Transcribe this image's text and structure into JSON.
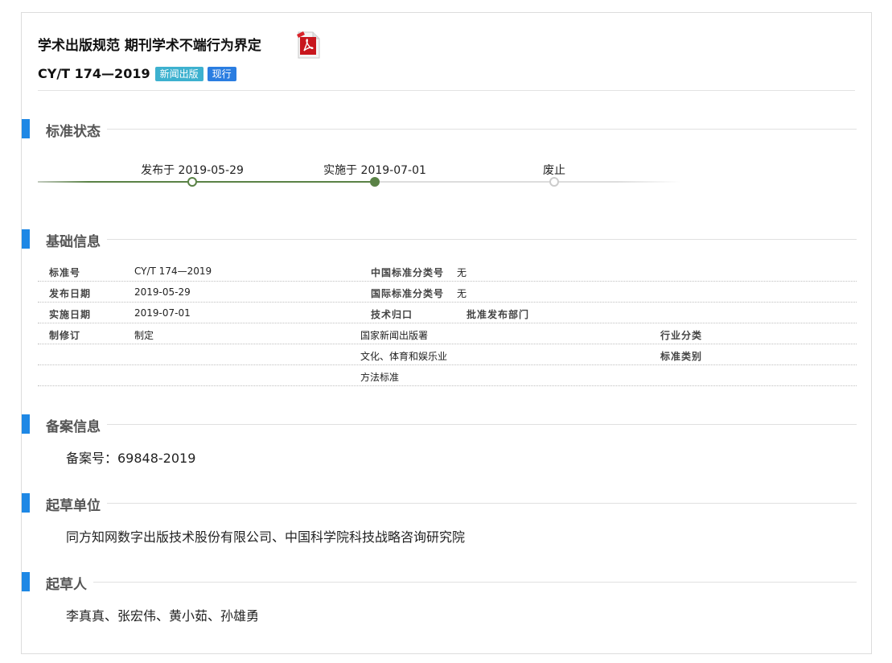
{
  "header": {
    "title": "学术出版规范 期刊学术不端行为界定",
    "pdf_icon": "pdf-icon",
    "standard_no": "CY/T 174—2019",
    "category_tag": "新闻出版",
    "status_tag": "现行",
    "colors": {
      "category_tag": "#3db1cf",
      "status_tag": "#2a7de1",
      "accent": "#1e88e5",
      "timeline": "#5a8246"
    }
  },
  "status_section": {
    "heading": "标准状态",
    "milestones": [
      {
        "label": "发布于 2019-05-29"
      },
      {
        "label": "实施于 2019-07-01"
      },
      {
        "label": "废止"
      }
    ]
  },
  "basic_section": {
    "heading": "基础信息",
    "rows": [
      {
        "k1": "标准号",
        "v1": "CY/T 174—2019",
        "k2": "中国标准分类号",
        "v2": "无"
      },
      {
        "k1": "发布日期",
        "v1": "2019-05-29",
        "k2": "国际标准分类号",
        "v2": "无"
      },
      {
        "k1": "实施日期",
        "v1": "2019-07-01",
        "k2": "技术归口",
        "v2": "批准发布部门"
      },
      {
        "k1": "制修订",
        "v1": "制定",
        "c3": "国家新闻出版署",
        "c4": "行业分类"
      },
      {
        "c3": "文化、体育和娱乐业",
        "c4": "标准类别"
      },
      {
        "c3": "方法标准"
      }
    ]
  },
  "record_section": {
    "heading": "备案信息",
    "text": "备案号：69848-2019"
  },
  "drafting_unit_section": {
    "heading": "起草单位",
    "text": "同方知网数字出版技术股份有限公司、中国科学院科技战略咨询研究院"
  },
  "drafters_section": {
    "heading": "起草人",
    "text": "李真真、张宏伟、黄小茹、孙雄勇"
  }
}
